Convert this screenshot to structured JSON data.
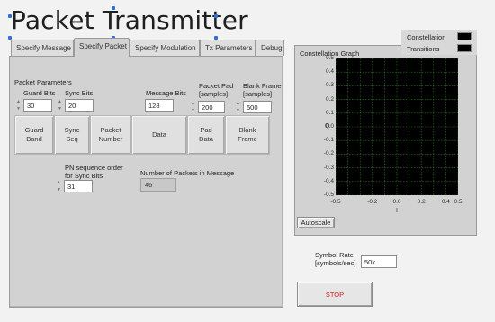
{
  "title": "Packet Transmitter",
  "tabs": [
    "Specify Message",
    "Specify Packet",
    "Specify Modulation",
    "Tx Parameters",
    "Debug"
  ],
  "active_tab": "Specify Packet",
  "packet_params": {
    "section_label": "Packet Parameters",
    "guard_bits_label": "Guard Bits",
    "guard_bits_value": "30",
    "sync_bits_label": "Sync Bits",
    "sync_bits_value": "20",
    "message_bits_label": "Message Bits",
    "message_bits_value": "128",
    "packet_pad_label_1": "Packet Pad",
    "packet_pad_label_2": "[samples]",
    "packet_pad_value": "200",
    "blank_frame_label_1": "Blank Frame",
    "blank_frame_label_2": "[samples]",
    "blank_frame_value": "500"
  },
  "packet_blocks": {
    "guard_band_1": "Guard",
    "guard_band_2": "Band",
    "sync_seq_1": "Sync",
    "sync_seq_2": "Seq",
    "packet_number_1": "Packet",
    "packet_number_2": "Number",
    "data": "Data",
    "pad_data_1": "Pad",
    "pad_data_2": "Data",
    "blank_frame_1": "Blank",
    "blank_frame_2": "Frame"
  },
  "pn": {
    "label_1": "PN sequence order",
    "label_2": "for Sync Bits",
    "value": "31"
  },
  "num_packets": {
    "label": "Number of Packets in Message",
    "value": "46"
  },
  "graph": {
    "title": "Constellation Graph",
    "legend": [
      "Constellation",
      "Transitions"
    ],
    "y_ticks": [
      "0.5",
      "0.4",
      "0.3",
      "0.2",
      "0.1",
      "0.0",
      "-0.1",
      "-0.2",
      "-0.3",
      "-0.4",
      "-0.5"
    ],
    "x_ticks": [
      "-0.5",
      "-0.2",
      "0.0",
      "0.2",
      "0.4",
      "0.5"
    ],
    "x_axis_label": "I",
    "y_axis_label": "Q",
    "autoscale_label": "Autoscale"
  },
  "symbol_rate": {
    "label_1": "Symbol Rate",
    "label_2": "[symbols/sec]",
    "value": "50k"
  },
  "stop_label": "STOP",
  "colors": {
    "plot_bg": "#000000",
    "grid": "#2e7d1f",
    "stop_text": "#d02020"
  }
}
